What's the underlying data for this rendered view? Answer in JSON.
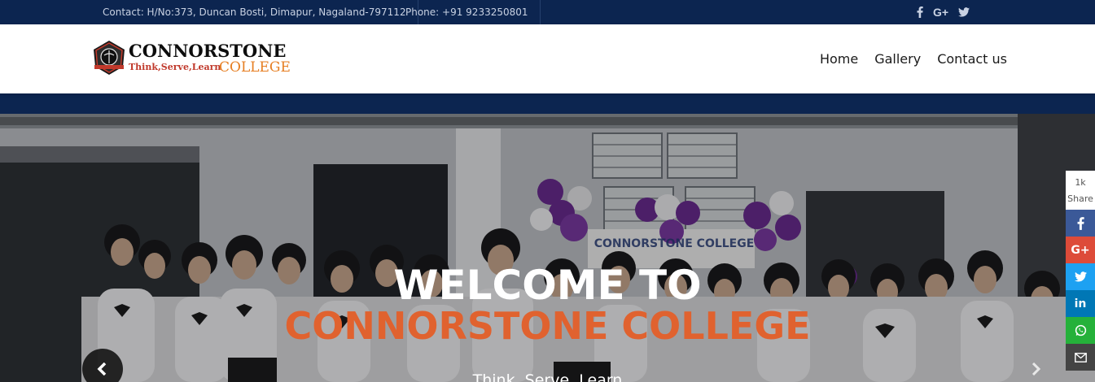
{
  "topbar": {
    "contact": "Contact: H/No:373, Duncan Bosti, Dimapur, Nagaland-797112",
    "phone": "Phone: +91 9233250801",
    "social_icons": [
      "facebook-icon",
      "google-plus-icon",
      "twitter-icon"
    ],
    "google_plus_label": "G+"
  },
  "logo": {
    "name": "CONNORSTONE",
    "tagline": "Think,Serve,Learn",
    "college": "COLLEGE"
  },
  "nav": {
    "items": [
      "Home",
      "Gallery",
      "Contact us"
    ]
  },
  "hero": {
    "welcome": "WELCOME TO",
    "title": "CONNORSTONE COLLEGE",
    "motto": "Think, Serve, Learn",
    "banner_text": "CONNORSTONE COLLEGE"
  },
  "share": {
    "count": "1k",
    "label": "Share",
    "google_plus_label": "G+",
    "linkedin_label": "in"
  },
  "colors": {
    "navy": "#0c2550",
    "accent_orange": "#e0622f",
    "facebook": "#3b5998",
    "google_plus": "#dd4b39",
    "twitter": "#1da1f2",
    "linkedin": "#0077b5",
    "whatsapp": "#25b13a",
    "email": "#444444"
  }
}
